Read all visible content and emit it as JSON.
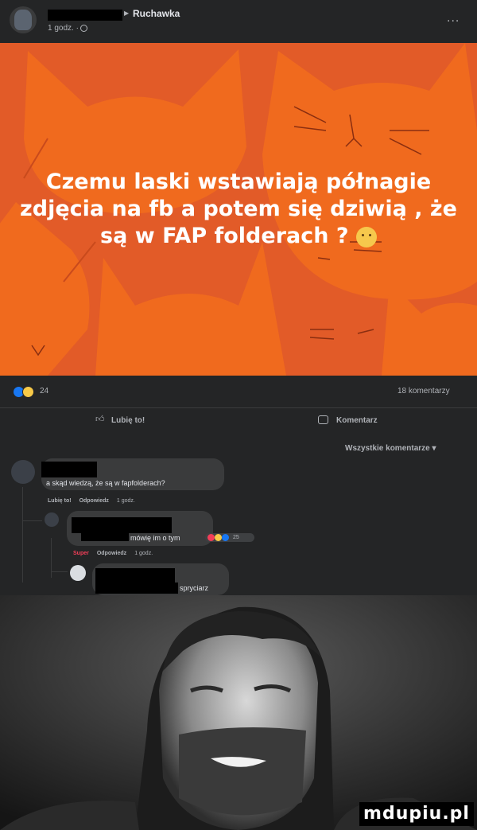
{
  "header": {
    "group_name": "Ruchawka",
    "meta": "1 godz. ·",
    "more": "..."
  },
  "post": {
    "text": "Czemu laski wstawiają półnagie zdjęcia na fb a potem się dziwią , że są w FAP folderach ?",
    "reaction_count": "24",
    "comment_count": "18 komentarzy",
    "like_label": "Lubię to!",
    "comment_label": "Komentarz",
    "sort_label": "Wszystkie komentarze ▾"
  },
  "comments": [
    {
      "text": "a skąd wiedzą, że są w fapfolderach?",
      "actions": [
        "Lubię to!",
        "Odpowiedz"
      ],
      "time": "1 godz."
    },
    {
      "text": "mówię im o tym",
      "reaction_count": "25",
      "actions": [
        "Super",
        "Odpowiedz"
      ],
      "time": "1 godz."
    },
    {
      "text": "spryciarz"
    }
  ],
  "watermark": "mdupiu.pl",
  "colors": {
    "banner": "#e25b28",
    "cats": "#f06a1e",
    "dark_bg": "#242526",
    "like_blue": "#1877f2",
    "super_red": "#f33e58"
  }
}
